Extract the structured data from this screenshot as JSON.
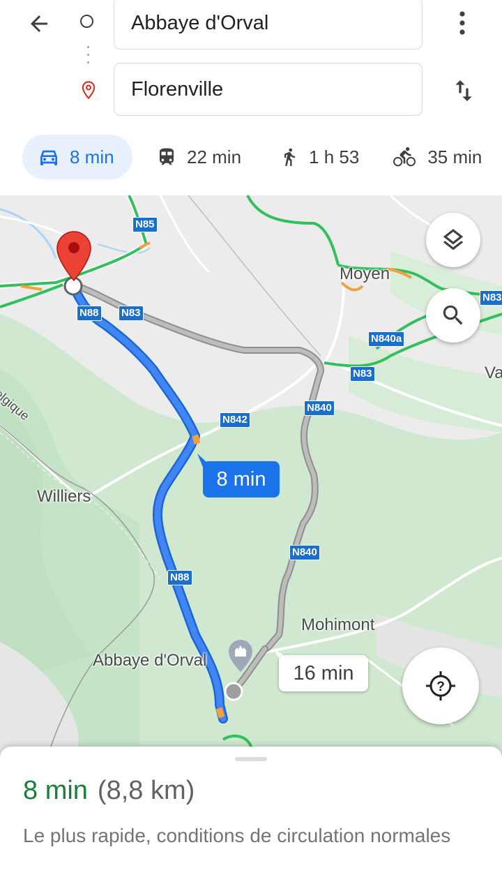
{
  "search": {
    "origin": "Abbaye d'Orval",
    "destination": "Florenville"
  },
  "modes": [
    {
      "icon": "car-icon",
      "label": "8 min",
      "active": true
    },
    {
      "icon": "train-icon",
      "label": "22 min",
      "active": false
    },
    {
      "icon": "walk-icon",
      "label": "1 h 53",
      "active": false
    },
    {
      "icon": "bike-icon",
      "label": "35 min",
      "active": false
    }
  ],
  "map": {
    "route_colors": {
      "primary": "#4285f4",
      "alternate": "#a8a8a8",
      "traffic_green": "#31c05b",
      "traffic_orange": "#f4a03e"
    },
    "road_labels": [
      "N85",
      "N88",
      "N83",
      "N83",
      "N840a",
      "N83",
      "N842",
      "N840",
      "N840",
      "N88"
    ],
    "places": [
      "Moyen",
      "Williers",
      "Mohimont",
      "Abbaye d'Orval",
      "Va",
      "elgique"
    ],
    "primary_route_time": "8 min",
    "alternate_route_time": "16 min"
  },
  "summary": {
    "time": "8 min",
    "distance": "(8,8 km)",
    "description": "Le plus rapide, conditions de circulation normales"
  }
}
